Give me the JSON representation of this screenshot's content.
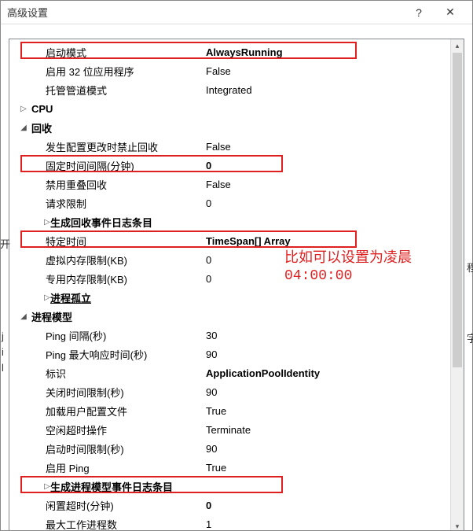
{
  "titlebar": {
    "title": "高级设置",
    "help": "?",
    "close": "✕"
  },
  "rows": [
    {
      "type": "item",
      "label": "启动模式",
      "value": "AlwaysRunning",
      "boldValue": true
    },
    {
      "type": "item",
      "label": "启用 32 位应用程序",
      "value": "False"
    },
    {
      "type": "item",
      "label": "托管管道模式",
      "value": "Integrated"
    },
    {
      "type": "cat",
      "label": "CPU",
      "expander": "▷"
    },
    {
      "type": "cat",
      "label": "回收",
      "expander": "◢"
    },
    {
      "type": "item",
      "label": "发生配置更改时禁止回收",
      "value": "False"
    },
    {
      "type": "item",
      "label": "固定时间间隔(分钟)",
      "value": "0",
      "boldValue": true
    },
    {
      "type": "item",
      "label": "禁用重叠回收",
      "value": "False"
    },
    {
      "type": "item",
      "label": "请求限制",
      "value": "0"
    },
    {
      "type": "subcat",
      "label": "生成回收事件日志条目",
      "expander": "▷"
    },
    {
      "type": "item",
      "label": "特定时间",
      "value": "TimeSpan[] Array",
      "boldValue": true
    },
    {
      "type": "item",
      "label": "虚拟内存限制(KB)",
      "value": "0"
    },
    {
      "type": "item",
      "label": "专用内存限制(KB)",
      "value": "0"
    },
    {
      "type": "subcat",
      "label": "进程孤立",
      "expander": "▷",
      "underline": true
    },
    {
      "type": "cat",
      "label": "进程模型",
      "expander": "◢"
    },
    {
      "type": "item",
      "label": "Ping 间隔(秒)",
      "value": "30"
    },
    {
      "type": "item",
      "label": "Ping 最大响应时间(秒)",
      "value": "90"
    },
    {
      "type": "item",
      "label": "标识",
      "value": "ApplicationPoolIdentity",
      "boldValue": true
    },
    {
      "type": "item",
      "label": "关闭时间限制(秒)",
      "value": "90"
    },
    {
      "type": "item",
      "label": "加载用户配置文件",
      "value": "True"
    },
    {
      "type": "item",
      "label": "空闲超时操作",
      "value": "Terminate"
    },
    {
      "type": "item",
      "label": "启动时间限制(秒)",
      "value": "90"
    },
    {
      "type": "item",
      "label": "启用 Ping",
      "value": "True"
    },
    {
      "type": "subcat",
      "label": "生成进程模型事件日志条目",
      "expander": "▷"
    },
    {
      "type": "item",
      "label": "闲置超时(分钟)",
      "value": "0",
      "boldValue": true
    },
    {
      "type": "item",
      "label": "最大工作进程数",
      "value": "1"
    }
  ],
  "annotation": {
    "line1": "比如可以设置为凌晨",
    "line2": "04:00:00"
  },
  "side": {
    "frag1": "开",
    "frag2": "j",
    "frag3": "i",
    "frag4": "l",
    "frag5": "程",
    "frag6": "字"
  }
}
